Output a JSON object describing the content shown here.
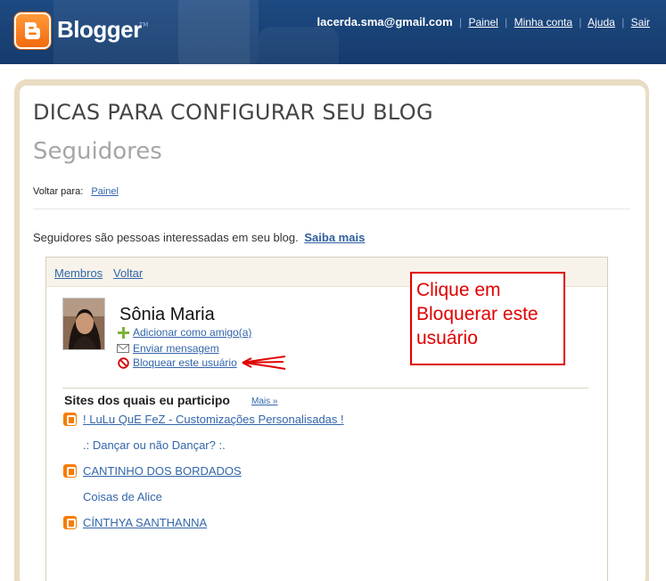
{
  "header": {
    "brand": "Blogger",
    "trademark": "TM",
    "user_email": "lacerda.sma@gmail.com",
    "links": [
      "Painel",
      "Minha conta",
      "Ajuda",
      "Sair"
    ]
  },
  "page": {
    "title": "DICAS PARA CONFIGURAR SEU BLOG",
    "subtitle": "Seguidores",
    "back_label": "Voltar para:",
    "back_link": "Painel",
    "intro_text": "Seguidores são pessoas interessadas em seu blog.",
    "intro_link": "Saiba mais"
  },
  "widget": {
    "tabs": [
      "Membros",
      "Voltar"
    ],
    "profile": {
      "name": "Sônia Maria",
      "actions": [
        {
          "label": "Adicionar como amigo(a)",
          "icon": "plus-icon"
        },
        {
          "label": "Enviar mensagem",
          "icon": "envelope-icon"
        },
        {
          "label": "Bloquear este usuário",
          "icon": "block-icon"
        }
      ]
    },
    "sites_heading": "Sites dos quais eu participo",
    "sites_more": "Mais »",
    "sites": [
      {
        "label": "! LuLu QuE FeZ - Customizações Personalisadas !",
        "icon": "blogger-icon"
      },
      {
        "label": ".: Dançar ou não Dançar? :.",
        "icon": ""
      },
      {
        "label": "CANTINHO DOS BORDADOS",
        "icon": "blogger-icon"
      },
      {
        "label": "Coisas de Alice",
        "icon": ""
      },
      {
        "label": "CÍNTHYA SANTHANNA",
        "icon": "blogger-icon"
      }
    ]
  },
  "callout": {
    "text": "Clique em Bloquerar este usuário",
    "color": "#e00000"
  },
  "colors": {
    "header_bg": "#1d4a82",
    "link": "#3366aa",
    "panel_frame": "#e9dcc3",
    "brand_orange": "#f57d00"
  }
}
